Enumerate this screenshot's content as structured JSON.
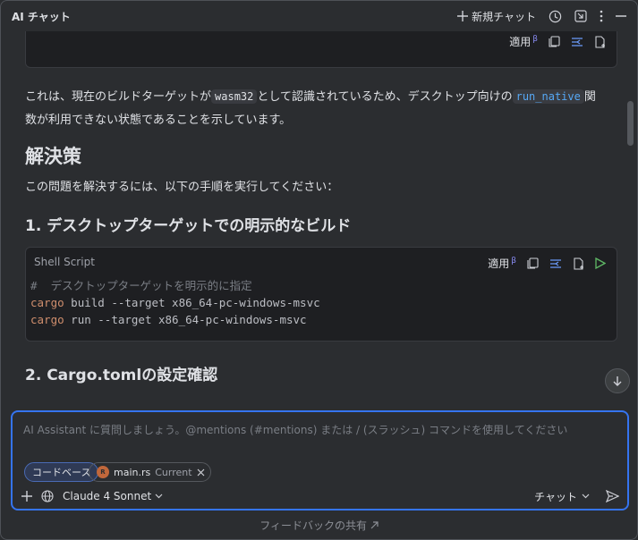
{
  "header": {
    "title": "AI チャット",
    "new_chat_label": "新規チャット"
  },
  "code_toolbar": {
    "apply_label": "適用",
    "beta": "β"
  },
  "content": {
    "para1_a": "これは、現在のビルドターゲットが",
    "para1_code1": "wasm32",
    "para1_b": "として認識されているため、デスクトップ向けの",
    "para1_code2": "run_native",
    "para1_c": "関数が利用できない状態であることを示しています。",
    "heading_solution": "解決策",
    "para2": "この問題を解決するには、以下の手順を実行してください：",
    "heading_step1": "1. デスクトップターゲットでの明示的なビルド",
    "code_lang": "Shell Script",
    "code_lines": [
      {
        "comment": "#  デスクトップターゲットを明示的に指定"
      },
      {
        "cmd": "cargo",
        "rest": " build --target x86_64-pc-windows-msvc"
      },
      {
        "cmd": "cargo",
        "rest": " run --target x86_64-pc-windows-msvc"
      }
    ],
    "heading_step2": "2. Cargo.tomlの設定確認"
  },
  "input": {
    "placeholder": "AI Assistant に質問しましょう。@mentions (#mentions) または / (スラッシュ) コマンドを使用してください",
    "chip_codebase": "コードベース",
    "chip_file": "main.rs",
    "chip_file_status": "Current",
    "model": "Claude 4 Sonnet",
    "mode": "チャット"
  },
  "footer": {
    "feedback": "フィードバックの共有"
  }
}
